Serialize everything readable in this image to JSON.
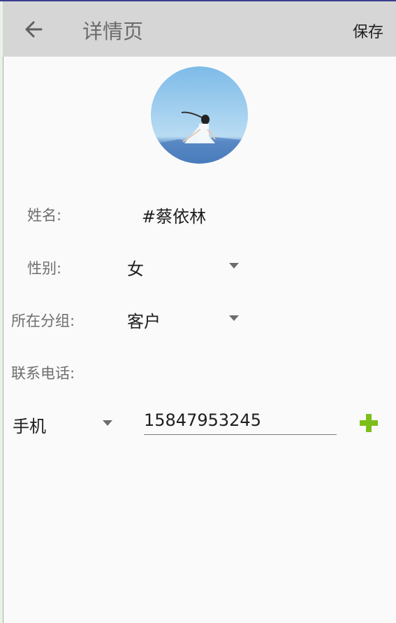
{
  "header": {
    "title": "详情页",
    "save_label": "保存"
  },
  "profile": {
    "name_label": "姓名:",
    "name_value": "#蔡依林",
    "gender_label": "性别:",
    "gender_value": "女",
    "group_label": "所在分组:",
    "group_value": "客户",
    "phone_section_label": "联系电话:",
    "phone_type": "手机",
    "phone_number": "15847953245"
  },
  "icons": {
    "back": "arrow-left-icon",
    "dropdown": "caret-down-icon",
    "add": "plus-icon",
    "avatar": "avatar-photo"
  },
  "colors": {
    "appbar": "#d6d6d6",
    "accent_add": "#7cbf1a",
    "background": "#fafafa"
  }
}
